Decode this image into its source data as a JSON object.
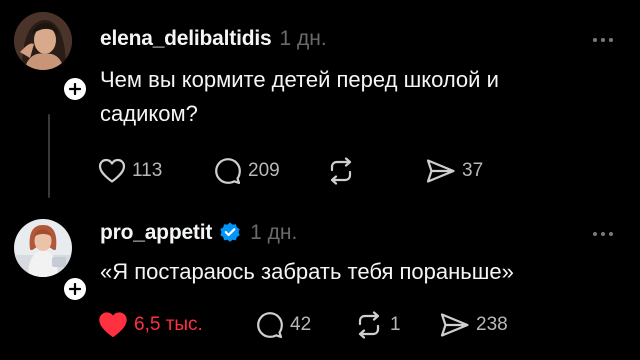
{
  "posts": [
    {
      "username": "elena_delibaltidis",
      "time": "1 дн.",
      "text_line1": "Чем вы кормите детей перед школой и",
      "text_line2": "садиком?",
      "likes": "113",
      "replies": "209",
      "reposts": "",
      "shares": "37",
      "liked": false,
      "verified": false
    },
    {
      "username": "pro_appetit",
      "time": "1 дн.",
      "text_line1": "«Я постараюсь забрать тебя пораньше»",
      "text_line2": "",
      "likes": "6,5 тыс.",
      "replies": "42",
      "reposts": "1",
      "shares": "238",
      "liked": true,
      "verified": true
    }
  ],
  "icons": {
    "like": "heart-icon",
    "reply": "comment-icon",
    "repost": "repost-icon",
    "share": "send-icon",
    "more": "more-icon",
    "follow": "plus-icon",
    "verified": "verified-badge-icon"
  },
  "colors": {
    "background": "#000000",
    "text": "#f3f5f7",
    "muted": "#6a6a6a",
    "like_active": "#ff3040",
    "verified": "#0095f6"
  }
}
